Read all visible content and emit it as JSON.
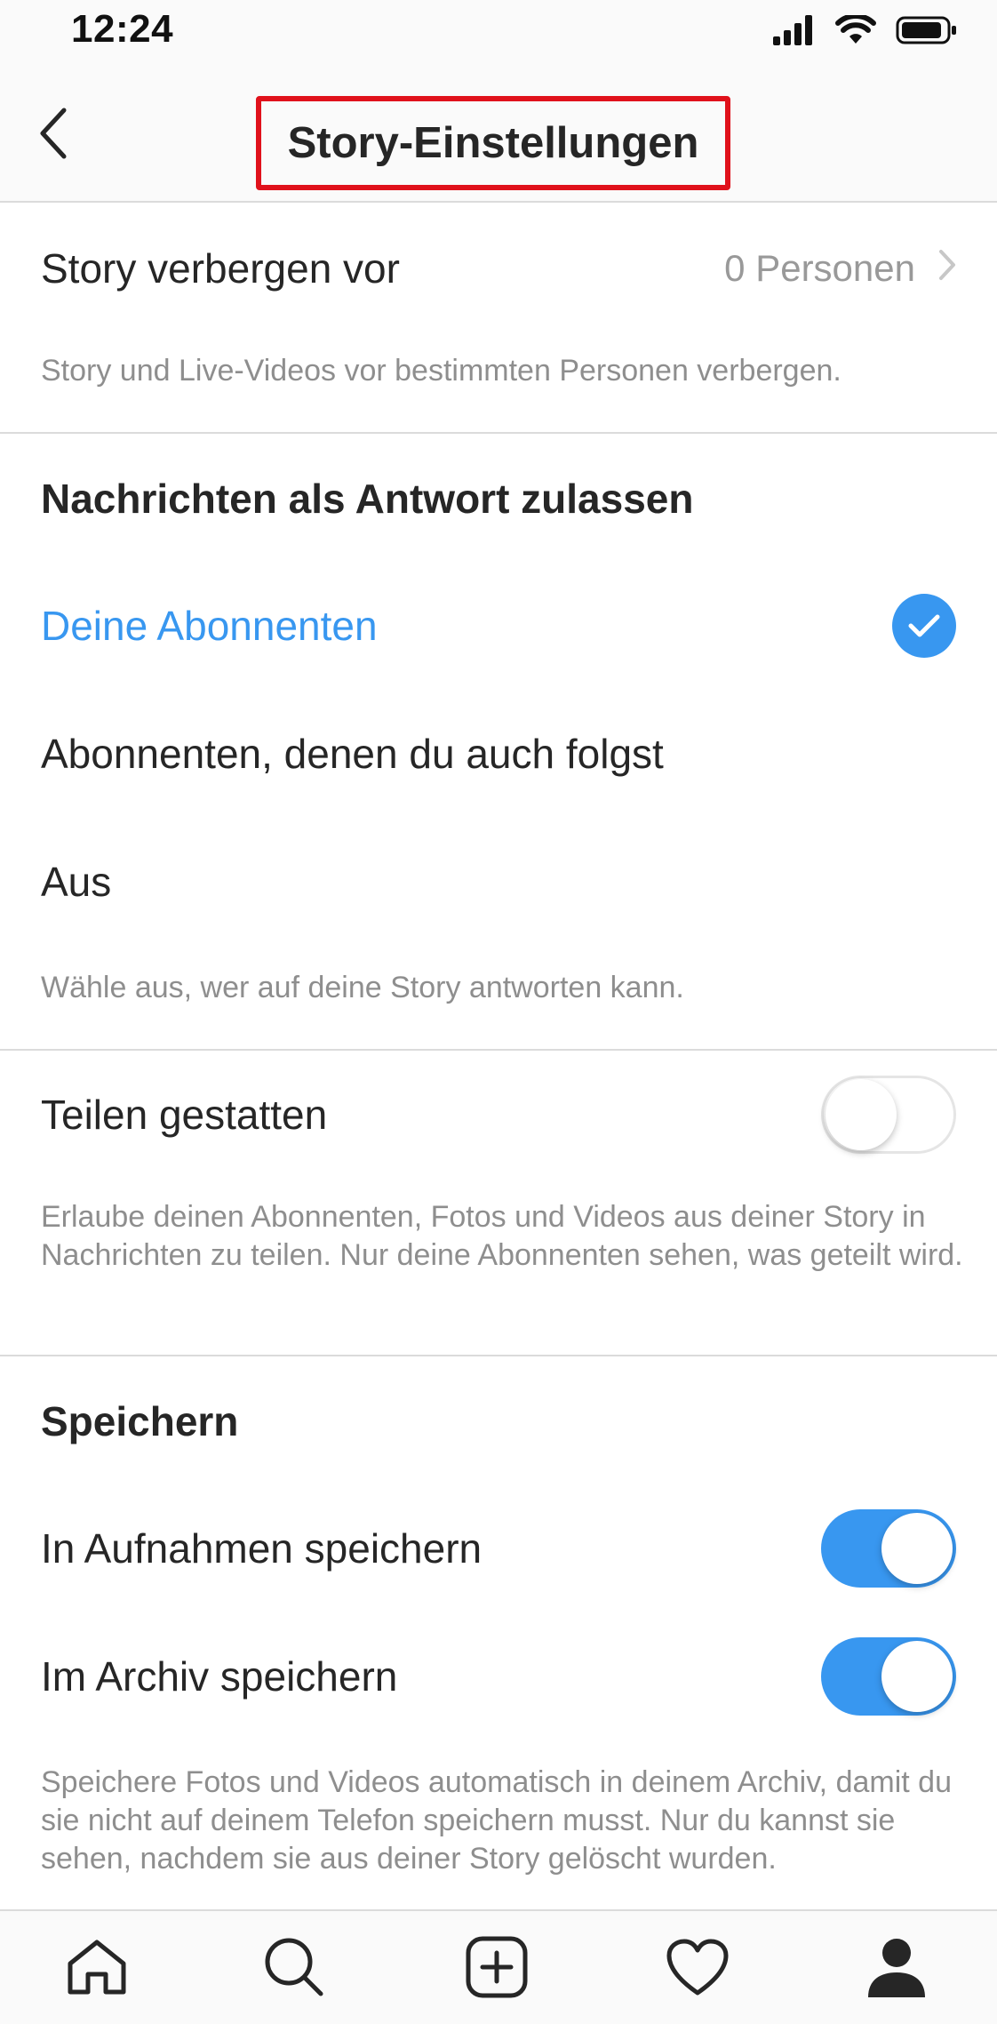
{
  "status_bar": {
    "time": "12:24",
    "icons": [
      "cellular-signal-icon",
      "wifi-icon",
      "battery-icon"
    ]
  },
  "header": {
    "title": "Story-Einstellungen",
    "back_icon": "chevron-left-icon"
  },
  "hide_story": {
    "label": "Story verbergen vor",
    "value": "0 Personen",
    "description": "Story und Live-Videos vor bestimmten Personen verbergen."
  },
  "replies": {
    "heading": "Nachrichten als Antwort zulassen",
    "options": [
      {
        "label": "Deine Abonnenten",
        "selected": true
      },
      {
        "label": "Abonnenten, denen du auch folgst",
        "selected": false
      },
      {
        "label": "Aus",
        "selected": false
      }
    ],
    "description": "Wähle aus, wer auf deine Story antworten kann."
  },
  "sharing": {
    "label": "Teilen gestatten",
    "enabled": false,
    "description": "Erlaube deinen Abonnenten, Fotos und Videos aus deiner Story in Nachrichten zu teilen. Nur deine Abonnenten sehen, was geteilt wird."
  },
  "saving": {
    "heading": "Speichern",
    "items": [
      {
        "label": "In Aufnahmen speichern",
        "enabled": true
      },
      {
        "label": "Im Archiv speichern",
        "enabled": true
      }
    ],
    "description": "Speichere Fotos und Videos automatisch in deinem Archiv, damit du sie nicht auf deinem Telefon speichern musst. Nur du kannst sie sehen, nachdem sie aus deiner Story gelöscht wurden."
  },
  "tab_bar": {
    "tabs": [
      "home-icon",
      "search-icon",
      "add-post-icon",
      "heart-icon",
      "profile-icon"
    ]
  },
  "colors": {
    "accent": "#3897f0",
    "highlight_border": "#e0111b",
    "secondary_text": "#8e8e8e",
    "divider": "#dbdbdb"
  }
}
